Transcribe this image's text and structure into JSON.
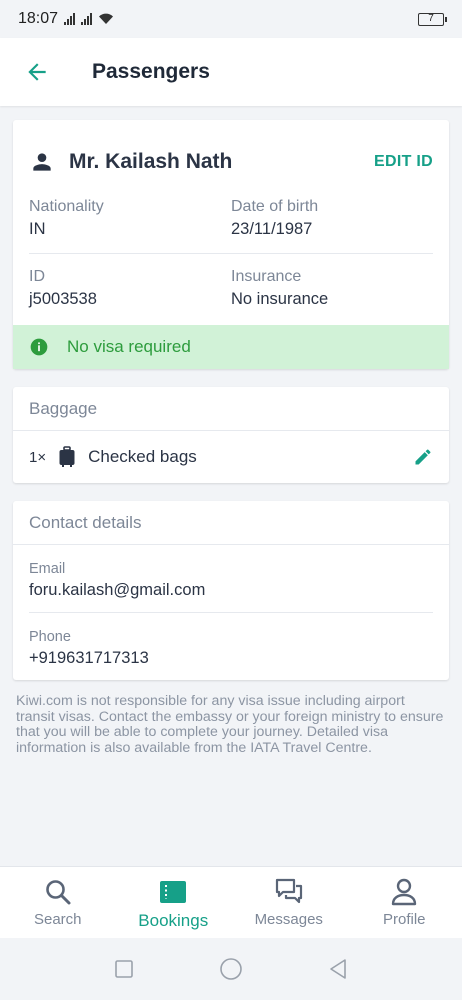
{
  "status": {
    "time": "18:07",
    "battery": "7"
  },
  "header": {
    "title": "Passengers"
  },
  "passenger": {
    "name": "Mr. Kailash Nath",
    "edit_label": "EDIT ID",
    "nationality_label": "Nationality",
    "nationality_value": "IN",
    "dob_label": "Date of birth",
    "dob_value": "23/11/1987",
    "id_label": "ID",
    "id_value": "j5003538",
    "insurance_label": "Insurance",
    "insurance_value": "No insurance",
    "visa_text": "No visa required"
  },
  "baggage": {
    "title": "Baggage",
    "qty": "1×",
    "label": "Checked bags"
  },
  "contact": {
    "title": "Contact details",
    "email_label": "Email",
    "email_value": "foru.kailash@gmail.com",
    "phone_label": "Phone",
    "phone_value": "+919631717313"
  },
  "disclaimer": "Kiwi.com is not responsible for any visa issue including airport transit visas. Contact the embassy or your foreign ministry to ensure that you will be able to complete your journey. Detailed visa information is also available from the IATA Travel Centre.",
  "nav": {
    "search": "Search",
    "bookings": "Bookings",
    "messages": "Messages",
    "profile": "Profile"
  },
  "colors": {
    "accent": "#16a088",
    "visa_bg": "#d1f2d7",
    "visa_text": "#2d9c3d"
  }
}
